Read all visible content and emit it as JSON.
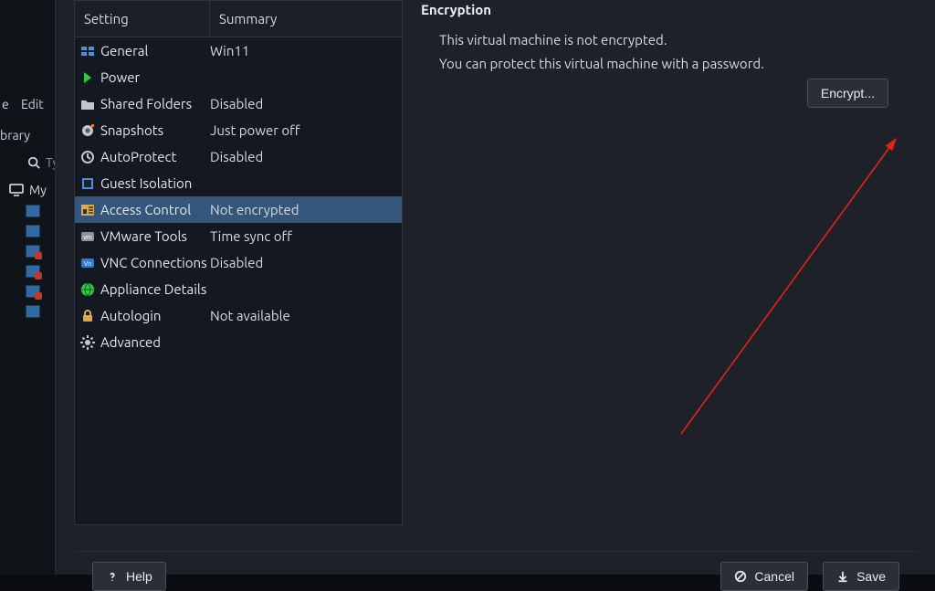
{
  "background": {
    "menu_edit": "Edit",
    "menu_file_partial": "e",
    "library_label": "brary",
    "search_placeholder": "Type",
    "tree_label": "My"
  },
  "table": {
    "header_setting": "Setting",
    "header_summary": "Summary",
    "rows": [
      {
        "icon": "general-icon",
        "label": "General",
        "summary": "Win11"
      },
      {
        "icon": "power-icon",
        "label": "Power",
        "summary": ""
      },
      {
        "icon": "folder-icon",
        "label": "Shared Folders",
        "summary": "Disabled"
      },
      {
        "icon": "snapshot-icon",
        "label": "Snapshots",
        "summary": "Just power off"
      },
      {
        "icon": "autoprotect-icon",
        "label": "AutoProtect",
        "summary": "Disabled"
      },
      {
        "icon": "guest-isolation-icon",
        "label": "Guest Isolation",
        "summary": ""
      },
      {
        "icon": "access-control-icon",
        "label": "Access Control",
        "summary": "Not encrypted",
        "selected": true
      },
      {
        "icon": "vmware-tools-icon",
        "label": "VMware Tools",
        "summary": "Time sync off"
      },
      {
        "icon": "vnc-icon",
        "label": "VNC Connections",
        "summary": "Disabled"
      },
      {
        "icon": "appliance-icon",
        "label": "Appliance Details",
        "summary": ""
      },
      {
        "icon": "autologin-icon",
        "label": "Autologin",
        "summary": "Not available"
      },
      {
        "icon": "advanced-icon",
        "label": "Advanced",
        "summary": ""
      }
    ]
  },
  "detail": {
    "title": "Encryption",
    "line1": "This virtual machine is not encrypted.",
    "line2": "You can protect this virtual machine with a password.",
    "encrypt_button": "Encrypt..."
  },
  "footer": {
    "help": "Help",
    "cancel": "Cancel",
    "save": "Save"
  }
}
